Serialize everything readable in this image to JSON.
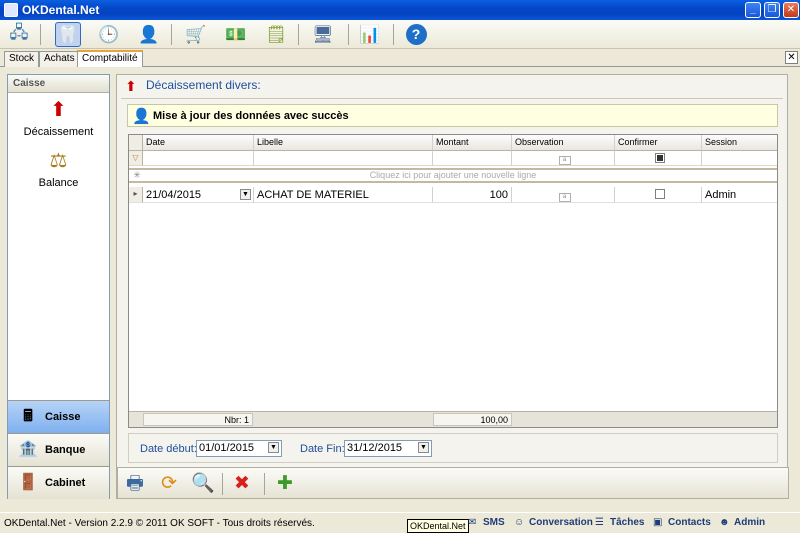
{
  "window": {
    "title": "OKDental.Net"
  },
  "toolbar": {
    "icons": [
      "network-icon",
      "tooth-icon",
      "clock-icon",
      "user-icon",
      "cart-icon",
      "money-icon",
      "notes-icon",
      "computer-icon",
      "chart-icon",
      "help-icon"
    ]
  },
  "tabs": [
    {
      "label": "Stock"
    },
    {
      "label": "Achats"
    },
    {
      "label": "Comptabilité"
    }
  ],
  "sidebar": {
    "header": "Caisse",
    "items": [
      {
        "label": "Décaissement"
      },
      {
        "label": "Balance"
      }
    ],
    "nav": [
      {
        "label": "Caisse"
      },
      {
        "label": "Banque"
      },
      {
        "label": "Cabinet"
      }
    ]
  },
  "main": {
    "title": "Décaissement divers:",
    "message": "Mise à jour des données avec succès"
  },
  "grid": {
    "columns": [
      "Date",
      "Libelle",
      "Montant",
      "Observation",
      "Confirmer",
      "Session"
    ],
    "new_row_hint": "Cliquez ici pour ajouter une nouvelle ligne",
    "rows": [
      {
        "date": "21/04/2015",
        "libelle": "ACHAT DE MATERIEL",
        "montant": "100",
        "observation": "",
        "confirmer": false,
        "session": "Admin"
      }
    ],
    "footer": {
      "count": "Nbr: 1",
      "total": "100,00"
    }
  },
  "filters": {
    "start_label": "Date début:",
    "start_value": "01/01/2015",
    "end_label": "Date Fin:",
    "end_value": "31/12/2015"
  },
  "statusbar": {
    "copyright": "OKDental.Net - Version 2.2.9 © 2011 OK SOFT - Tous droits réservés.",
    "tooltip": "OKDental.Net",
    "items": [
      {
        "label": "SMS"
      },
      {
        "label": "Conversation"
      },
      {
        "label": "Tâches"
      },
      {
        "label": "Contacts"
      },
      {
        "label": "Admin"
      }
    ]
  }
}
